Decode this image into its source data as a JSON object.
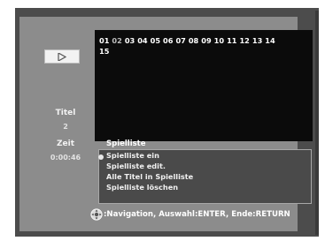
{
  "player": {
    "play_icon": "play-icon"
  },
  "info": {
    "title_label": "Titel",
    "title_value": "2",
    "time_label": "Zeit",
    "time_value": "0:00:46"
  },
  "titles": {
    "selected": "02",
    "row1": [
      "01",
      "02",
      "03",
      "04",
      "05",
      "06",
      "07",
      "08",
      "09",
      "10",
      "11",
      "12",
      "13",
      "14"
    ],
    "row2": [
      "15"
    ]
  },
  "menu": {
    "header": "Spielliste",
    "items": [
      "Spielliste ein",
      "Spielliste edit.",
      "Alle Titel in Spielliste",
      "Spielliste löschen"
    ]
  },
  "footer": {
    "icon": "navigation-dpad-icon",
    "hint": ":Navigation, Auswahl:ENTER, Ende:RETURN"
  }
}
